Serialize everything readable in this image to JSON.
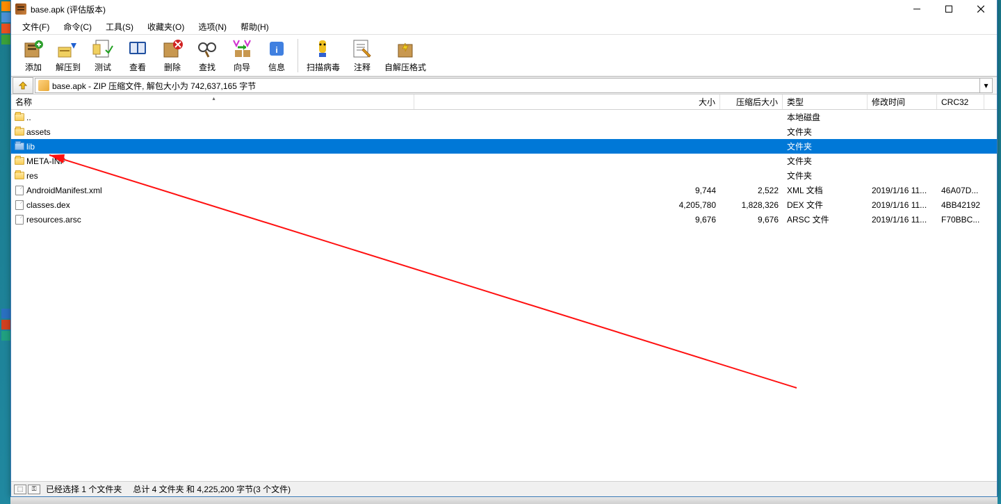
{
  "titlebar": {
    "title": "base.apk (评估版本)"
  },
  "menu": {
    "file": "文件(F)",
    "commands": "命令(C)",
    "tools": "工具(S)",
    "favorites": "收藏夹(O)",
    "options": "选项(N)",
    "help": "帮助(H)"
  },
  "toolbar": {
    "add": "添加",
    "extract_to": "解压到",
    "test": "测试",
    "view": "查看",
    "delete": "删除",
    "find": "查找",
    "wizard": "向导",
    "info": "信息",
    "scan_virus": "扫描病毒",
    "comment": "注释",
    "sfx": "自解压格式"
  },
  "pathbar": {
    "text": "base.apk - ZIP 压缩文件, 解包大小为 742,637,165 字节"
  },
  "columns": {
    "name": "名称",
    "size": "大小",
    "compressed": "压缩后大小",
    "type": "类型",
    "modified": "修改时间",
    "crc": "CRC32"
  },
  "rows": [
    {
      "name": "..",
      "icon": "folder",
      "size": "",
      "compressed": "",
      "type": "本地磁盘",
      "modified": "",
      "crc": "",
      "selected": false
    },
    {
      "name": "assets",
      "icon": "folder",
      "size": "",
      "compressed": "",
      "type": "文件夹",
      "modified": "",
      "crc": "",
      "selected": false
    },
    {
      "name": "lib",
      "icon": "folder",
      "size": "",
      "compressed": "",
      "type": "文件夹",
      "modified": "",
      "crc": "",
      "selected": true
    },
    {
      "name": "META-INF",
      "icon": "folder",
      "size": "",
      "compressed": "",
      "type": "文件夹",
      "modified": "",
      "crc": "",
      "selected": false
    },
    {
      "name": "res",
      "icon": "folder",
      "size": "",
      "compressed": "",
      "type": "文件夹",
      "modified": "",
      "crc": "",
      "selected": false
    },
    {
      "name": "AndroidManifest.xml",
      "icon": "file",
      "size": "9,744",
      "compressed": "2,522",
      "type": "XML 文档",
      "modified": "2019/1/16 11...",
      "crc": "46A07D...",
      "selected": false
    },
    {
      "name": "classes.dex",
      "icon": "file",
      "size": "4,205,780",
      "compressed": "1,828,326",
      "type": "DEX 文件",
      "modified": "2019/1/16 11...",
      "crc": "4BB42192",
      "selected": false
    },
    {
      "name": "resources.arsc",
      "icon": "file",
      "size": "9,676",
      "compressed": "9,676",
      "type": "ARSC 文件",
      "modified": "2019/1/16 11...",
      "crc": "F70BBC...",
      "selected": false
    }
  ],
  "statusbar": {
    "left": "已经选择 1 个文件夹",
    "center": "总计 4 文件夹 和 4,225,200 字节(3 个文件)"
  }
}
